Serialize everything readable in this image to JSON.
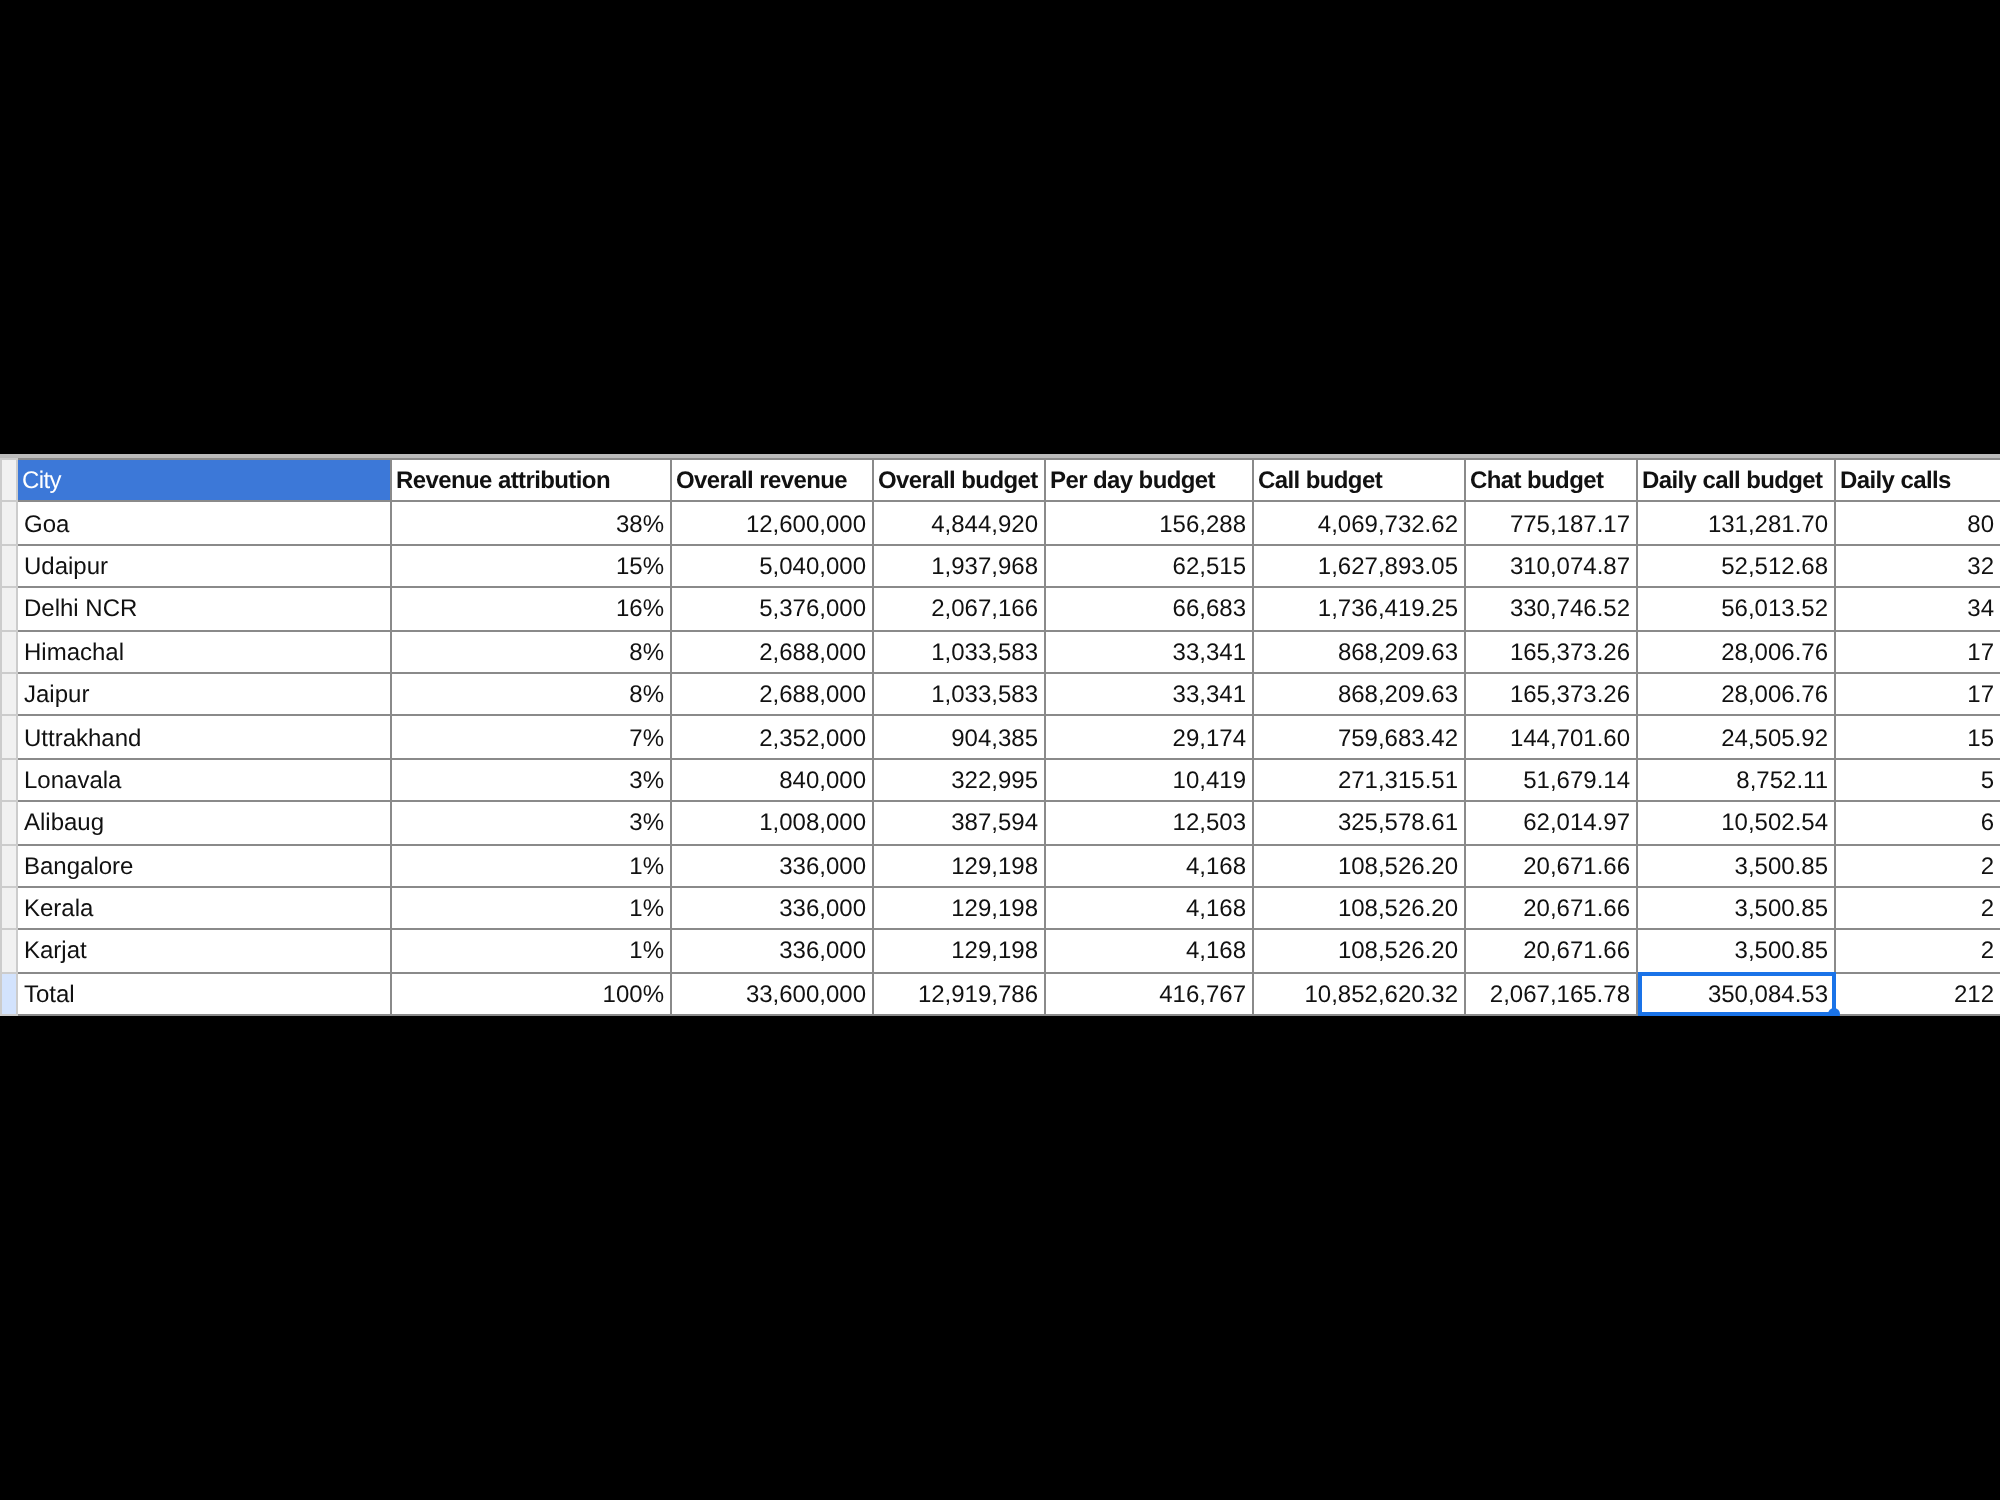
{
  "table": {
    "columns": [
      {
        "label": "City",
        "highlighted": true,
        "selected": false
      },
      {
        "label": "Revenue attribution",
        "highlighted": false,
        "selected": false
      },
      {
        "label": "Overall revenue",
        "highlighted": false,
        "selected": false
      },
      {
        "label": "Overall budget",
        "highlighted": false,
        "selected": false
      },
      {
        "label": "Per day budget",
        "highlighted": false,
        "selected": false
      },
      {
        "label": "Call budget",
        "highlighted": false,
        "selected": false
      },
      {
        "label": "Chat budget",
        "highlighted": false,
        "selected": false
      },
      {
        "label": "Daily call budget",
        "highlighted": false,
        "selected": true
      },
      {
        "label": "Daily calls",
        "highlighted": false,
        "selected": false
      }
    ],
    "rows": [
      {
        "selected": false,
        "cells": [
          "Goa",
          "38%",
          "12,600,000",
          "4,844,920",
          "156,288",
          "4,069,732.62",
          "775,187.17",
          "131,281.70",
          "80"
        ]
      },
      {
        "selected": false,
        "cells": [
          "Udaipur",
          "15%",
          "5,040,000",
          "1,937,968",
          "62,515",
          "1,627,893.05",
          "310,074.87",
          "52,512.68",
          "32"
        ]
      },
      {
        "selected": false,
        "cells": [
          "Delhi NCR",
          "16%",
          "5,376,000",
          "2,067,166",
          "66,683",
          "1,736,419.25",
          "330,746.52",
          "56,013.52",
          "34"
        ]
      },
      {
        "selected": false,
        "cells": [
          "Himachal",
          "8%",
          "2,688,000",
          "1,033,583",
          "33,341",
          "868,209.63",
          "165,373.26",
          "28,006.76",
          "17"
        ]
      },
      {
        "selected": false,
        "cells": [
          "Jaipur",
          "8%",
          "2,688,000",
          "1,033,583",
          "33,341",
          "868,209.63",
          "165,373.26",
          "28,006.76",
          "17"
        ]
      },
      {
        "selected": false,
        "cells": [
          "Uttrakhand",
          "7%",
          "2,352,000",
          "904,385",
          "29,174",
          "759,683.42",
          "144,701.60",
          "24,505.92",
          "15"
        ]
      },
      {
        "selected": false,
        "cells": [
          "Lonavala",
          "3%",
          "840,000",
          "322,995",
          "10,419",
          "271,315.51",
          "51,679.14",
          "8,752.11",
          "5"
        ]
      },
      {
        "selected": false,
        "cells": [
          "Alibaug",
          "3%",
          "1,008,000",
          "387,594",
          "12,503",
          "325,578.61",
          "62,014.97",
          "10,502.54",
          "6"
        ]
      },
      {
        "selected": false,
        "cells": [
          "Bangalore",
          "1%",
          "336,000",
          "129,198",
          "4,168",
          "108,526.20",
          "20,671.66",
          "3,500.85",
          "2"
        ]
      },
      {
        "selected": false,
        "cells": [
          "Kerala",
          "1%",
          "336,000",
          "129,198",
          "4,168",
          "108,526.20",
          "20,671.66",
          "3,500.85",
          "2"
        ]
      },
      {
        "selected": false,
        "cells": [
          "Karjat",
          "1%",
          "336,000",
          "129,198",
          "4,168",
          "108,526.20",
          "20,671.66",
          "3,500.85",
          "2"
        ]
      },
      {
        "selected": true,
        "cells": [
          "Total",
          "100%",
          "33,600,000",
          "12,919,786",
          "416,767",
          "10,852,620.32",
          "2,067,165.78",
          "350,084.53",
          "212"
        ]
      }
    ]
  }
}
